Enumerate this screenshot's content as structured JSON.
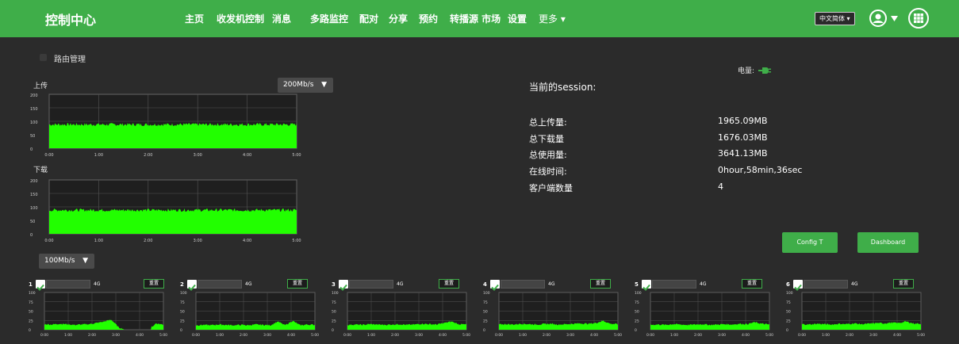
{
  "header": {
    "brand": "控制中心",
    "nav": [
      {
        "label": "主页"
      },
      {
        "label": "收发机控制"
      },
      {
        "label": "消息"
      },
      {
        "label": "多路监控"
      },
      {
        "label": "配对"
      },
      {
        "label": "分享"
      },
      {
        "label": "预约"
      },
      {
        "label": "转播源 市场"
      },
      {
        "label": "设置"
      },
      {
        "label": "更多 ▾"
      }
    ],
    "language": "中文简体 ▾",
    "user_icon": "user-circle-icon",
    "menu_icon": "grid-menu-icon",
    "accent_color": "#3fae49"
  },
  "panel": {
    "title": "路由管理",
    "upload": {
      "label": "上传",
      "speed_option": "200Mb/s",
      "chart_data": {
        "type": "area",
        "x_ticks": [
          "0:00",
          "1:00",
          "2:00",
          "3:00",
          "4:00",
          "5:00"
        ],
        "y_ticks": [
          "0",
          "50",
          "100",
          "150",
          "200"
        ],
        "ylim": [
          0,
          200
        ],
        "xlim": [
          0,
          5
        ],
        "mean_value": 88,
        "series_color": "#22ff00"
      }
    },
    "download": {
      "label": "下载",
      "chart_data": {
        "type": "area",
        "x_ticks": [
          "0:00",
          "1:00",
          "2:00",
          "3:00",
          "4:00",
          "5:00"
        ],
        "y_ticks": [
          "0",
          "50",
          "100",
          "150",
          "200"
        ],
        "ylim": [
          0,
          200
        ],
        "xlim": [
          0,
          5
        ],
        "mean_value": 88,
        "series_color": "#22ff00"
      }
    },
    "lower_speed_option": "100Mb/s"
  },
  "power_label": "电量:",
  "session": {
    "title": "当前的session:",
    "stats": [
      {
        "label": "总上传量:",
        "value": "1965.09MB"
      },
      {
        "label": "总下载量",
        "value": "1676.03MB"
      },
      {
        "label": "总使用量:",
        "value": "3641.13MB"
      },
      {
        "label": "在线时间:",
        "value": "0hour,58min,36sec"
      },
      {
        "label": "客户端数量",
        "value": "4"
      }
    ]
  },
  "buttons": {
    "config": "Config T",
    "dashboard": "Dashboard"
  },
  "channels": [
    {
      "num": "1",
      "band": "4G",
      "btn": "重置",
      "levels": [
        15,
        14,
        16,
        15,
        13,
        14,
        15,
        18,
        22,
        27,
        6,
        0,
        0,
        0,
        0,
        17,
        14
      ],
      "gap": [
        0.67,
        0.9
      ]
    },
    {
      "num": "2",
      "band": "4G",
      "btn": "重置",
      "levels": [
        12,
        13,
        12,
        14,
        13,
        12,
        13,
        12,
        14,
        13,
        12,
        22,
        12,
        24,
        12,
        14,
        13
      ],
      "gap": null
    },
    {
      "num": "3",
      "band": "4G",
      "btn": "重置",
      "levels": [
        13,
        14,
        13,
        15,
        14,
        13,
        14,
        15,
        13,
        14,
        16,
        15,
        14,
        18,
        22,
        15,
        14
      ],
      "gap": null
    },
    {
      "num": "4",
      "band": "4G",
      "btn": "重置",
      "levels": [
        14,
        15,
        14,
        16,
        15,
        14,
        15,
        16,
        14,
        15,
        16,
        17,
        16,
        18,
        24,
        16,
        15
      ],
      "gap": null
    },
    {
      "num": "5",
      "band": "4G",
      "btn": "重置",
      "levels": [
        13,
        14,
        13,
        15,
        14,
        13,
        14,
        15,
        13,
        14,
        15,
        14,
        16,
        15,
        20,
        16,
        14
      ],
      "gap": null
    },
    {
      "num": "6",
      "band": "4G",
      "btn": "重置",
      "levels": [
        15,
        14,
        16,
        15,
        14,
        16,
        15,
        17,
        15,
        16,
        18,
        17,
        19,
        18,
        22,
        17,
        16
      ],
      "gap": null
    }
  ],
  "channel_chart": {
    "x_ticks": [
      "0:00",
      "1:00",
      "2:00",
      "3:00",
      "4:00",
      "5:00"
    ],
    "y_ticks": [
      "0",
      "25",
      "50",
      "75",
      "100"
    ],
    "ylim": [
      0,
      100
    ]
  }
}
